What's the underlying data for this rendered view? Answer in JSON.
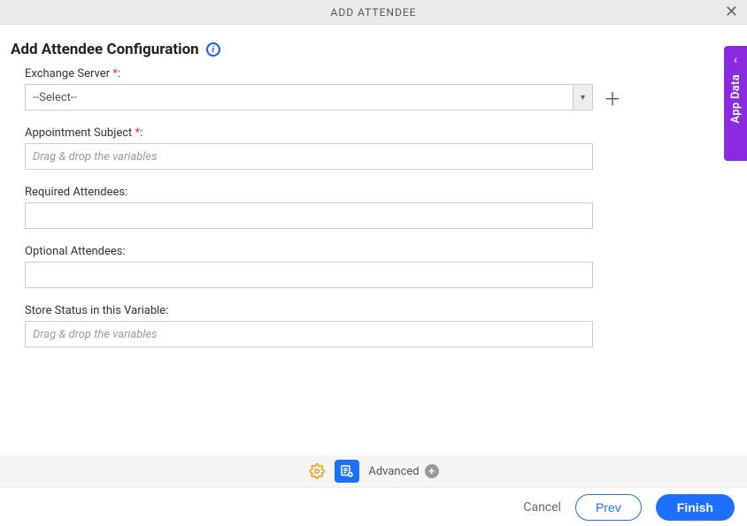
{
  "header": {
    "title": "ADD ATTENDEE"
  },
  "page": {
    "title": "Add Attendee Configuration"
  },
  "form": {
    "exchange_server": {
      "label": "Exchange Server",
      "required_mark": " *",
      "colon": ":",
      "selected": "--Select--"
    },
    "appointment_subject": {
      "label": "Appointment Subject",
      "required_mark": " *",
      "colon": ":",
      "placeholder": "Drag & drop the variables",
      "value": ""
    },
    "required_attendees": {
      "label": "Required Attendees:",
      "value": ""
    },
    "optional_attendees": {
      "label": "Optional Attendees:",
      "value": ""
    },
    "store_status": {
      "label": "Store Status in this Variable:",
      "placeholder": "Drag & drop the variables",
      "value": ""
    }
  },
  "toolbar": {
    "advanced_label": "Advanced"
  },
  "footer": {
    "cancel": "Cancel",
    "prev": "Prev",
    "finish": "Finish"
  },
  "side_panel": {
    "label": "App Data"
  }
}
